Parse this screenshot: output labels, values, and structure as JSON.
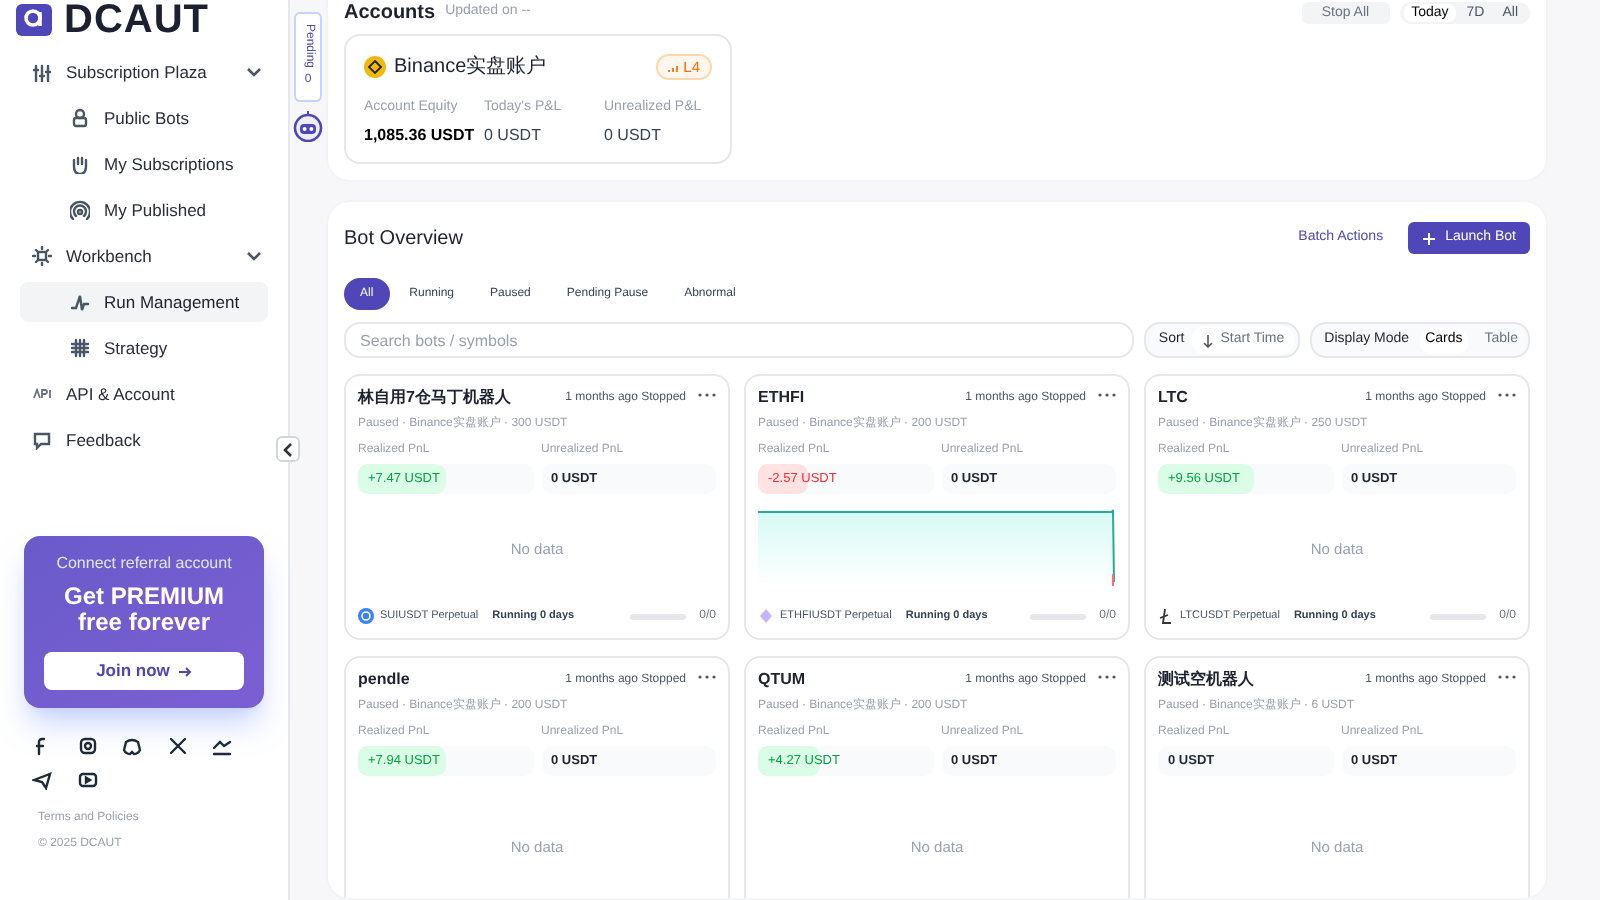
{
  "logo": {
    "text": "DCAUT"
  },
  "sidebar": {
    "items": [
      {
        "label": "Subscription Plaza",
        "expanded": true,
        "selected": false,
        "children": [
          {
            "label": "Public Bots",
            "selected": false
          },
          {
            "label": "My Subscriptions",
            "selected": false
          },
          {
            "label": "My Published",
            "selected": false
          }
        ]
      },
      {
        "label": "Workbench",
        "expanded": true,
        "selected": false,
        "children": [
          {
            "label": "Run Management",
            "selected": true
          },
          {
            "label": "Strategy",
            "selected": false
          }
        ]
      },
      {
        "label": "API & Account",
        "selected": false
      },
      {
        "label": "Feedback",
        "selected": false
      }
    ]
  },
  "promo": {
    "subtitle": "Connect referral account",
    "title": "Get PREMIUM free forever",
    "button": "Join now"
  },
  "footer": {
    "terms": "Terms and Policies",
    "copyright": "© 2025 DCAUT"
  },
  "pending_tab": {
    "label": "Pending",
    "count": "0"
  },
  "accounts": {
    "title": "Accounts",
    "updated": "Updated on --",
    "stop_all": "Stop All",
    "ranges": [
      {
        "label": "Today",
        "selected": true
      },
      {
        "label": "7D",
        "selected": false
      },
      {
        "label": "All",
        "selected": false
      }
    ],
    "cards": [
      {
        "name": "Binance实盘账户",
        "badge": "L4",
        "equity_label": "Account Equity",
        "equity": "1,085.36 USDT",
        "pnl_label": "Today's P&L",
        "pnl": "0 USDT",
        "unrealized_label": "Unrealized P&L",
        "unrealized": "0 USDT"
      }
    ]
  },
  "bot_overview": {
    "title": "Bot Overview",
    "batch": "Batch Actions",
    "launch": "Launch Bot",
    "filters": [
      {
        "label": "All",
        "selected": true
      },
      {
        "label": "Running",
        "selected": false
      },
      {
        "label": "Paused",
        "selected": false
      },
      {
        "label": "Pending Pause",
        "selected": false
      },
      {
        "label": "Abnormal",
        "selected": false
      }
    ],
    "search": {
      "placeholder": "Search bots / symbols"
    },
    "sort": {
      "label": "Sort",
      "value": "Start Time"
    },
    "display_mode": {
      "label": "Display Mode",
      "options": [
        {
          "label": "Cards",
          "selected": true
        },
        {
          "label": "Table",
          "selected": false
        }
      ]
    },
    "bots": [
      {
        "name": "林自用7仓马丁机器人",
        "status": "1 months ago Stopped",
        "meta": "Paused · Binance实盘账户 · 300 USDT",
        "realized_label": "Realized PnL",
        "realized": "+7.47 USDT",
        "kind": "gain",
        "level": 0.5,
        "unrealized_label": "Unrealized PnL",
        "unrealized": "0 USDT",
        "empty_text": "No data",
        "symbol": "SUIUSDT Perpetual",
        "runtime": "Running 0 days",
        "progress": {
          "text": "0/0"
        }
      },
      {
        "name": "ETHFI",
        "status": "1 months ago Stopped",
        "meta": "Paused · Binance实盘账户 · 200 USDT",
        "realized_label": "Realized PnL",
        "realized": "-2.57 USDT",
        "kind": "loss",
        "level": 0.28,
        "unrealized_label": "Unrealized PnL",
        "unrealized": "0 USDT",
        "symbol": "ETHFIUSDT Perpetual",
        "runtime": "Running 0 days",
        "progress": {
          "text": "0/0"
        }
      },
      {
        "name": "LTC",
        "status": "1 months ago Stopped",
        "meta": "Paused · Binance实盘账户 · 250 USDT",
        "realized_label": "Realized PnL",
        "realized": "+9.56 USDT",
        "kind": "gain",
        "level": 0.55,
        "unrealized_label": "Unrealized PnL",
        "unrealized": "0 USDT",
        "empty_text": "No data",
        "symbol": "LTCUSDT Perpetual",
        "runtime": "Running 0 days",
        "progress": {
          "text": "0/0"
        }
      },
      {
        "name": "pendle",
        "status": "1 months ago Stopped",
        "meta": "Paused · Binance实盘账户 · 200 USDT",
        "realized_label": "Realized PnL",
        "realized": "+7.94 USDT",
        "kind": "gain",
        "level": 0.5,
        "unrealized_label": "Unrealized PnL",
        "unrealized": "0 USDT",
        "empty_text": "No data"
      },
      {
        "name": "QTUM",
        "status": "1 months ago Stopped",
        "meta": "Paused · Binance实盘账户 · 200 USDT",
        "realized_label": "Realized PnL",
        "realized": "+4.27 USDT",
        "kind": "gain",
        "level": 0.35,
        "unrealized_label": "Unrealized PnL",
        "unrealized": "0 USDT",
        "empty_text": "No data"
      },
      {
        "name": "测试空机器人",
        "status": "1 months ago Stopped",
        "meta": "Paused · Binance实盘账户 · 6 USDT",
        "realized_label": "Realized PnL",
        "realized": "0 USDT",
        "kind": "flat",
        "unrealized_label": "Unrealized PnL",
        "unrealized": "0 USDT",
        "empty_text": "No data"
      }
    ]
  }
}
